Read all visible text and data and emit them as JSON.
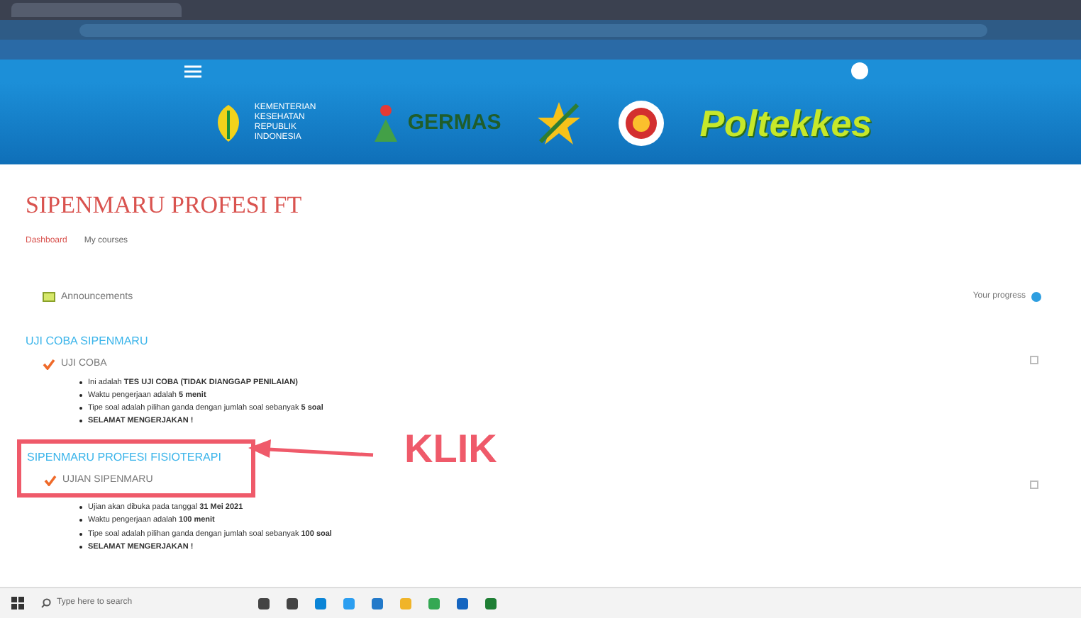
{
  "banner": {
    "logos": [
      {
        "kind": "ministry",
        "text": "KEMENTERIAN KESEHATAN REPUBLIK INDONESIA"
      },
      {
        "kind": "germas",
        "text": "GERMAS"
      },
      {
        "kind": "emblem"
      },
      {
        "kind": "seal"
      },
      {
        "kind": "wordmark",
        "text": "Poltekkes"
      }
    ]
  },
  "course": {
    "title": "SIPENMARU PROFESI FT",
    "breadcrumb": [
      {
        "label": "Dashboard",
        "selected": false
      },
      {
        "label": "My courses",
        "selected": false
      }
    ],
    "announcements": "Announcements",
    "progress": "Your progress"
  },
  "sections": [
    {
      "title": "UJI COBA SIPENMARU",
      "highlighted": false,
      "activity": {
        "name": "UJI COBA",
        "completed": false
      },
      "bullets": [
        "Ini adalah **TES UJI COBA (TIDAK DIANGGAP PENILAIAN)**",
        "Waktu pengerjaan adalah **5 menit**",
        "Tipe soal adalah pilihan ganda dengan jumlah soal sebanyak **5 soal**",
        "**SELAMAT MENGERJAKAN !**"
      ]
    },
    {
      "title": "SIPENMARU PROFESI FISIOTERAPI",
      "highlighted": true,
      "activity": {
        "name": "UJIAN SIPENMARU",
        "completed": false
      },
      "bullets": [
        "Ujian akan dibuka pada tanggal **31 Mei 2021**",
        "Waktu pengerjaan adalah **100 menit**",
        "Tipe soal adalah pilihan ganda dengan jumlah soal sebanyak **100 soal**",
        "**SELAMAT MENGERJAKAN !**"
      ]
    }
  ],
  "callout": "KLIK",
  "taskbar": {
    "search_placeholder": "Type here to search"
  }
}
